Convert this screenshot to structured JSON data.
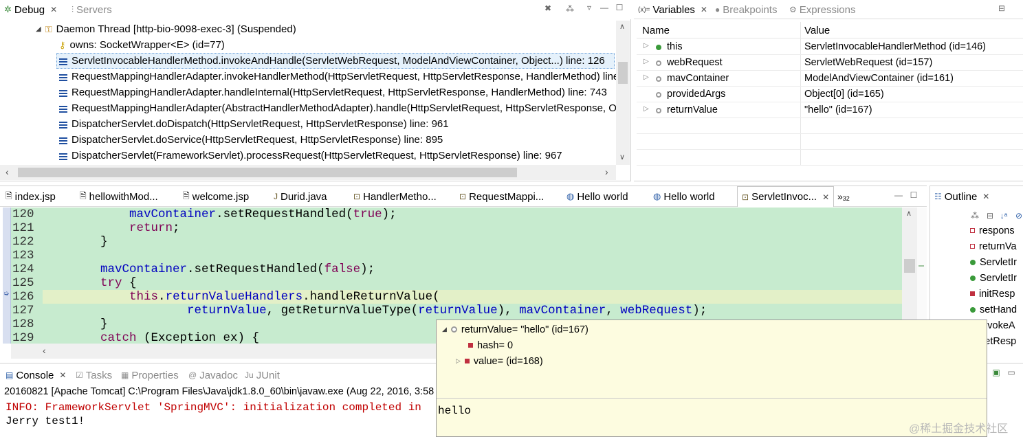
{
  "debug": {
    "tabs": [
      {
        "label": "Debug"
      },
      {
        "label": "Servers"
      }
    ],
    "thread": "Daemon Thread [http-bio-9098-exec-3] (Suspended)",
    "owns": "owns: SocketWrapper<E>  (id=77)",
    "frames": [
      "ServletInvocableHandlerMethod.invokeAndHandle(ServletWebRequest, ModelAndViewContainer, Object...) line: 126",
      "RequestMappingHandlerAdapter.invokeHandlerMethod(HttpServletRequest, HttpServletResponse, HandlerMethod) line",
      "RequestMappingHandlerAdapter.handleInternal(HttpServletRequest, HttpServletResponse, HandlerMethod) line: 743",
      "RequestMappingHandlerAdapter(AbstractHandlerMethodAdapter).handle(HttpServletRequest, HttpServletResponse, Ol",
      "DispatcherServlet.doDispatch(HttpServletRequest, HttpServletResponse) line: 961",
      "DispatcherServlet.doService(HttpServletRequest, HttpServletResponse) line: 895",
      "DispatcherServlet(FrameworkServlet).processRequest(HttpServletRequest, HttpServletResponse) line: 967"
    ]
  },
  "variables": {
    "tabs": [
      {
        "label": "Variables"
      },
      {
        "label": "Breakpoints"
      },
      {
        "label": "Expressions"
      }
    ],
    "icon_prefix": "(x)=",
    "headers": {
      "name": "Name",
      "value": "Value"
    },
    "rows": [
      {
        "name": "this",
        "value": "ServletInvocableHandlerMethod  (id=146)"
      },
      {
        "name": "webRequest",
        "value": "ServletWebRequest  (id=157)"
      },
      {
        "name": "mavContainer",
        "value": "ModelAndViewContainer  (id=161)"
      },
      {
        "name": "providedArgs",
        "value": "Object[0]  (id=165)"
      },
      {
        "name": "returnValue",
        "value": "\"hello\" (id=167)"
      }
    ]
  },
  "editor": {
    "tabs": [
      {
        "label": "index.jsp"
      },
      {
        "label": "hellowithMod..."
      },
      {
        "label": "welcome.jsp"
      },
      {
        "label": "Durid.java"
      },
      {
        "label": "HandlerMetho..."
      },
      {
        "label": "RequestMappi..."
      },
      {
        "label": "Hello world"
      },
      {
        "label": "Hello world"
      },
      {
        "label": "ServletInvoc..."
      }
    ],
    "overflow": "»",
    "overflow_count": "32",
    "line_numbers": [
      "120",
      "121",
      "122",
      "123",
      "124",
      "125",
      "126",
      "127",
      "128",
      "129"
    ]
  },
  "outline": {
    "title": "Outline",
    "items": [
      "respons",
      "returnVa",
      "ServletIr",
      "ServletIr",
      "initResp",
      "setHand",
      "invokeA",
      "setResp"
    ]
  },
  "console": {
    "tabs": [
      {
        "label": "Console"
      },
      {
        "label": "Tasks"
      },
      {
        "label": "Properties"
      },
      {
        "label": "Javadoc"
      },
      {
        "label": "JUnit"
      }
    ],
    "launch": "20160821 [Apache Tomcat] C:\\Program Files\\Java\\jdk1.8.0_60\\bin\\javaw.exe (Aug 22, 2016, 3:58",
    "line1": "INFO: FrameworkServlet 'SpringMVC': initialization completed in",
    "line2": "Jerry test1!"
  },
  "hover": {
    "root": "returnValue= \"hello\" (id=167)",
    "child1": "hash= 0",
    "child2": "value= (id=168)",
    "detail": "hello"
  },
  "watermark": "@稀土掘金技术社区",
  "colors": {
    "code_bg": "#c7ebcf",
    "current_line": "#dbe8b0",
    "hover_bg": "#fdfce0",
    "error": "#c00000",
    "keyword": "#7f0055",
    "field": "#0000c0"
  }
}
